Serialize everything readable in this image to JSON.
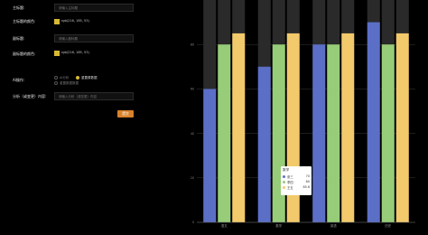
{
  "form": {
    "title_label": "主标题:",
    "title_placeholder": "请输入主标题",
    "title_color_label": "主标题的颜色:",
    "title_color_value": "rgb(216, 185, 53)",
    "subtitle_label": "副标题:",
    "subtitle_placeholder": "请输入副标题",
    "subtitle_color_label": "副标题的颜色:",
    "subtitle_color_value": "rgb(216, 185, 53)",
    "swatch_color": "#d8b935",
    "operation_label": "AI操作:",
    "radio_options": [
      "AI分析",
      "重置原数据",
      "重置数据数据"
    ],
    "analysis_label": "分析（或变更）内容:",
    "analysis_placeholder": "请输入分析（或变更）内容",
    "submit_label": "提交"
  },
  "chart_data": {
    "type": "bar",
    "categories": [
      "语文",
      "数学",
      "英语",
      "历史"
    ],
    "series": [
      {
        "name": "张三",
        "values": [
          60,
          70,
          80,
          90
        ],
        "color": "#5b6fc7"
      },
      {
        "name": "李四",
        "values": [
          80,
          80,
          80,
          80
        ],
        "color": "#97cc78"
      },
      {
        "name": "王五",
        "values": [
          85,
          85,
          85,
          85
        ],
        "color": "#f2c96b"
      }
    ],
    "ylim": [
      0,
      100
    ],
    "yticks": [
      0,
      20,
      40,
      60,
      80
    ],
    "grid": true,
    "background_bar_color": "#2a2a2a"
  },
  "tooltip": {
    "category": "数学",
    "rows": [
      {
        "name": "张三",
        "value": "70",
        "color": "#5b6fc7"
      },
      {
        "name": "李四",
        "value": "80",
        "color": "#97cc78"
      },
      {
        "name": "王五",
        "value": "85.6",
        "color": "#f2c96b"
      }
    ]
  }
}
